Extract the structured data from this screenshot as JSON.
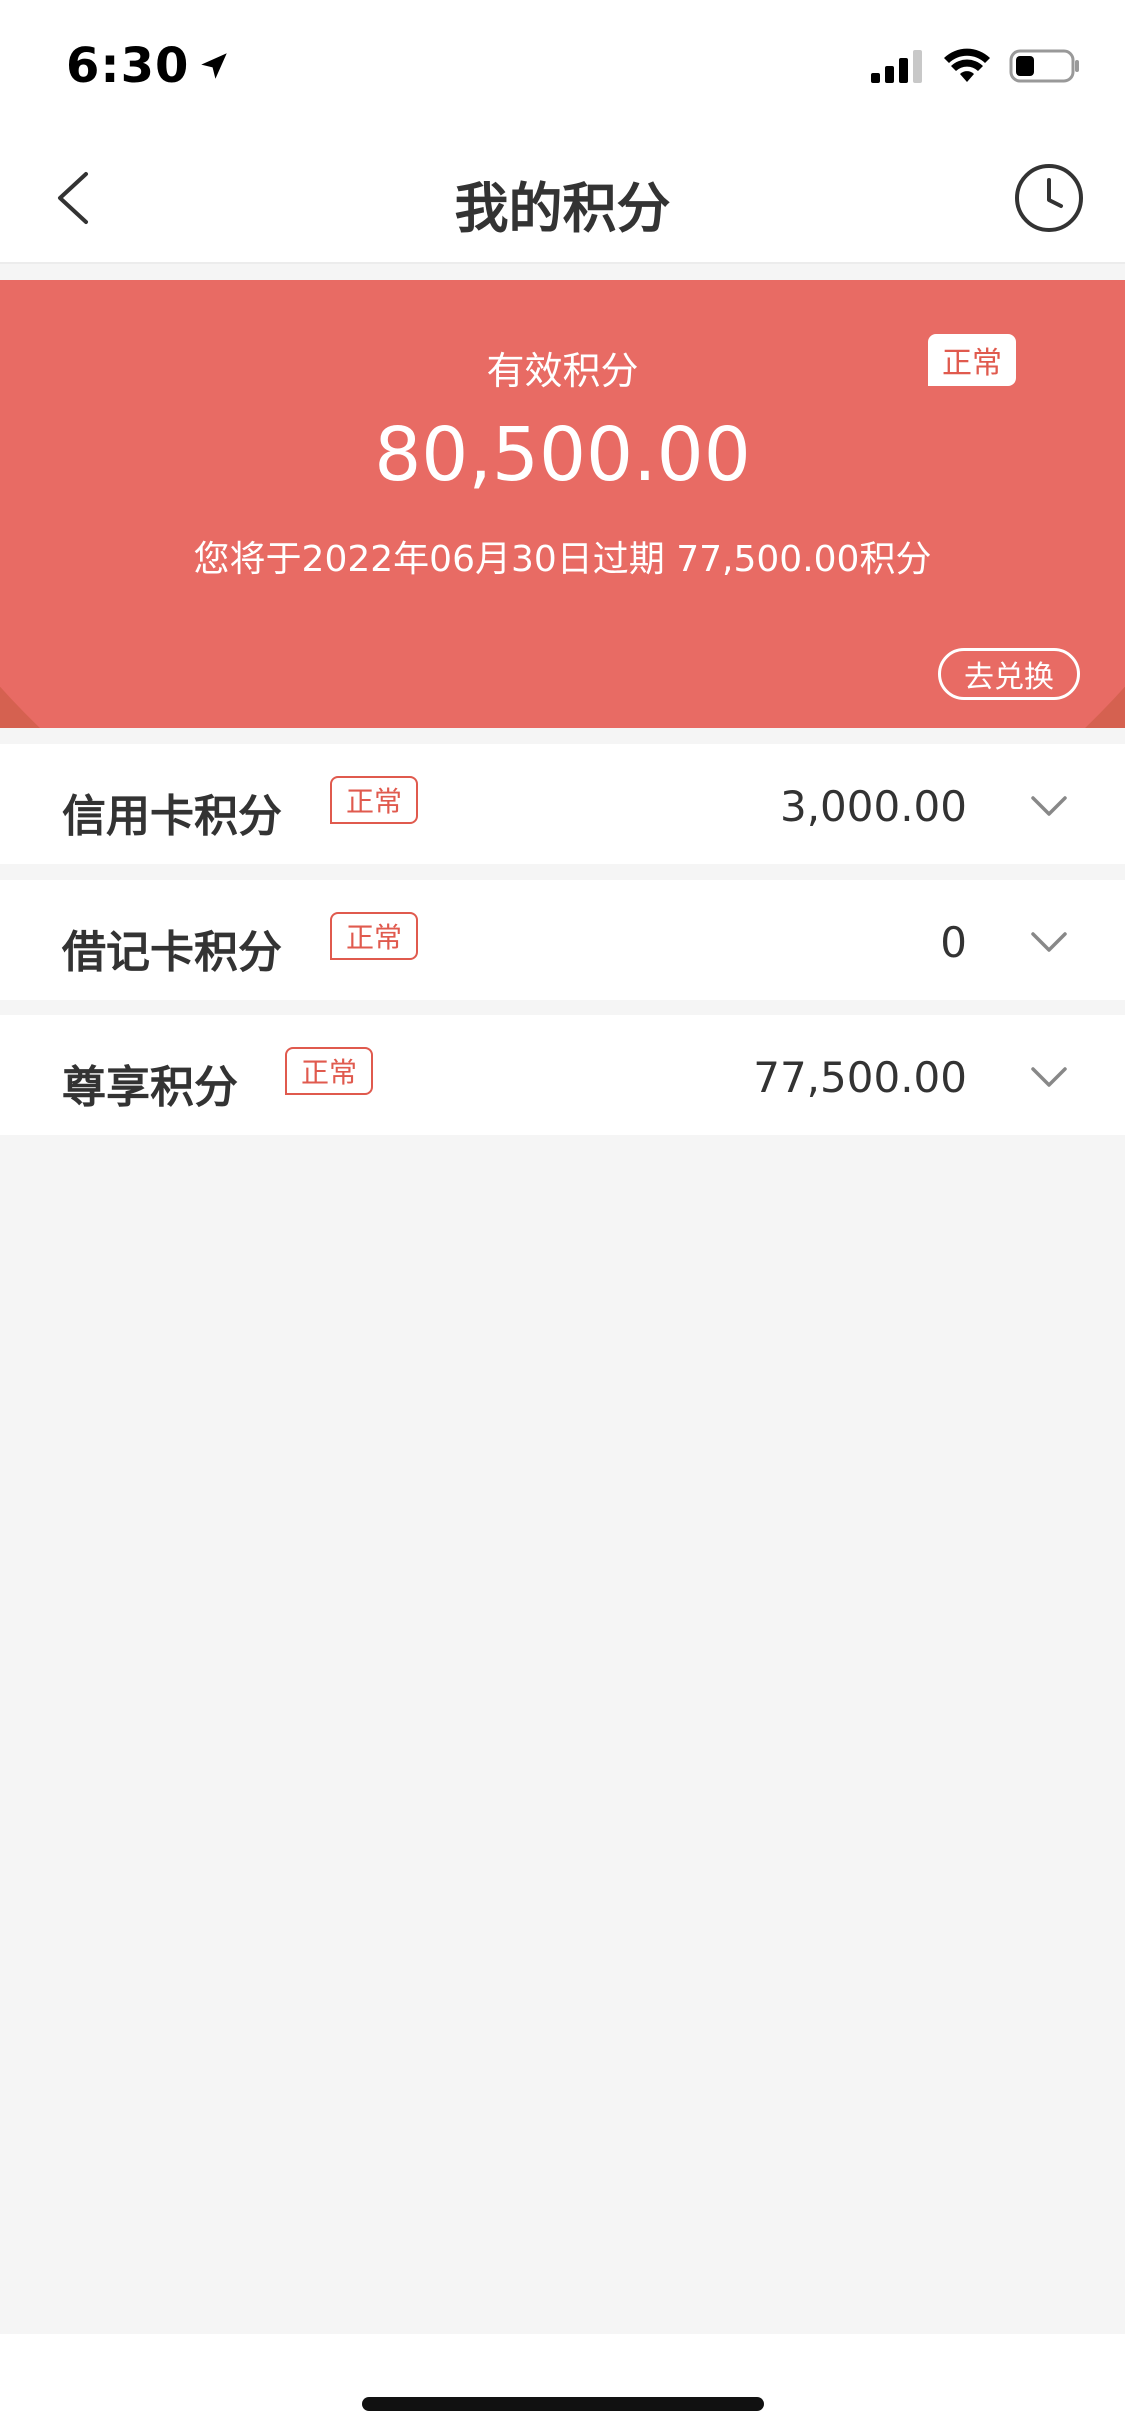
{
  "status_bar": {
    "time": "6:30"
  },
  "nav": {
    "title": "我的积分"
  },
  "summary": {
    "label": "有效积分",
    "status": "正常",
    "amount": "80,500.00",
    "expiry_note": "您将于2022年06月30日过期 77,500.00积分",
    "redeem_label": "去兑换"
  },
  "accounts": [
    {
      "label": "信用卡积分",
      "status": "正常",
      "value": "3,000.00"
    },
    {
      "label": "借记卡积分",
      "status": "正常",
      "value": "0"
    },
    {
      "label": "尊享积分",
      "status": "正常",
      "value": "77,500.00"
    }
  ],
  "colors": {
    "accent": "#e05a4e",
    "banner": "#e86b64"
  }
}
